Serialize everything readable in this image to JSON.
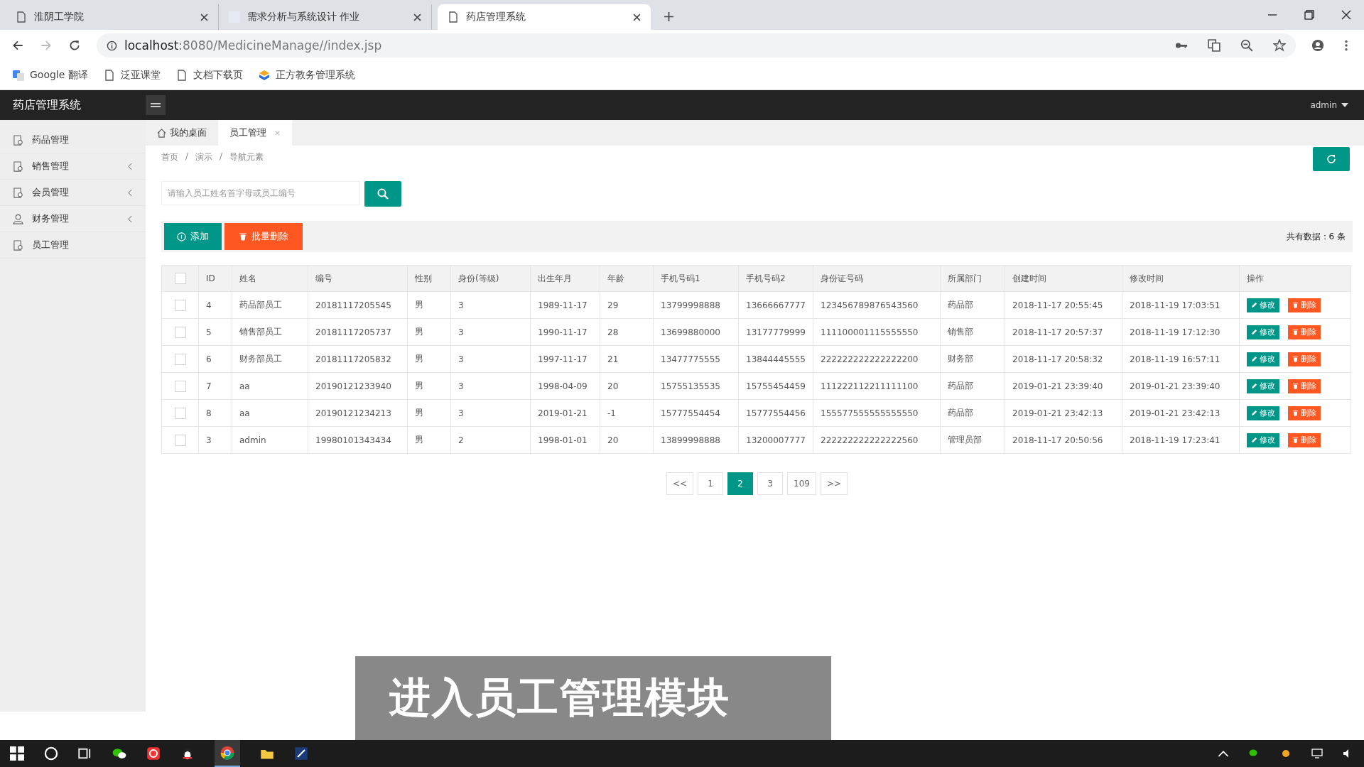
{
  "browser": {
    "tabs": [
      {
        "title": "淮阴工学院",
        "selected": false,
        "kind": "page"
      },
      {
        "title": "需求分析与系统设计  作业",
        "selected": false,
        "kind": "site"
      },
      {
        "title": "药店管理系统",
        "selected": true,
        "kind": "page"
      }
    ],
    "address": {
      "host": "localhost",
      "rest": ":8080/MedicineManage//index.jsp"
    },
    "bookmarks": [
      {
        "label": "Google 翻译",
        "kind": "translate"
      },
      {
        "label": "泛亚课堂",
        "kind": "page"
      },
      {
        "label": "文档下载页",
        "kind": "page"
      },
      {
        "label": "正方教务管理系统",
        "kind": "site"
      }
    ]
  },
  "app": {
    "title": "药店管理系统",
    "user": "admin",
    "sidebar": [
      {
        "label": "药品管理",
        "kind": "document",
        "expandable": false
      },
      {
        "label": "销售管理",
        "kind": "document",
        "expandable": true
      },
      {
        "label": "会员管理",
        "kind": "document",
        "expandable": true
      },
      {
        "label": "财务管理",
        "kind": "person",
        "expandable": true
      },
      {
        "label": "员工管理",
        "kind": "document",
        "expandable": false
      }
    ],
    "tabs": [
      {
        "label": "我的桌面",
        "selected": false,
        "kind": "home"
      },
      {
        "label": "员工管理",
        "selected": true,
        "kind": "closable"
      }
    ],
    "breadcrumb": [
      {
        "label": "首页"
      },
      {
        "separator": "/",
        "label": "演示"
      },
      {
        "separator": "/",
        "label": "导航元素"
      }
    ],
    "search": {
      "placeholder": "请输入员工姓名首字母或员工编号"
    },
    "toolbar": {
      "add": "添加",
      "batch_delete": "批量删除",
      "total": "共有数据：6 条"
    },
    "table": {
      "select_all_checked": false,
      "columns": [
        "ID",
        "姓名",
        "编号",
        "性别",
        "身份(等级)",
        "出生年月",
        "年龄",
        "手机号码1",
        "手机号码2",
        "身份证号码",
        "所属部门",
        "创建时间",
        "修改时间",
        "操作"
      ],
      "rows": [
        {
          "checked": false,
          "edit": "修改",
          "delete": "删除",
          "cells": [
            "4",
            "药品部员工",
            "20181117205545",
            "男",
            "3",
            "1989-11-17",
            "29",
            "13799998888",
            "13666667777",
            "123456789876543560",
            "药品部",
            "2018-11-17 20:55:45",
            "2018-11-19 17:03:51"
          ]
        },
        {
          "checked": false,
          "edit": "修改",
          "delete": "删除",
          "cells": [
            "5",
            "销售部员工",
            "20181117205737",
            "男",
            "3",
            "1990-11-17",
            "28",
            "13699880000",
            "13177779999",
            "111100001115555550",
            "销售部",
            "2018-11-17 20:57:37",
            "2018-11-19 17:12:30"
          ]
        },
        {
          "checked": false,
          "edit": "修改",
          "delete": "删除",
          "cells": [
            "6",
            "财务部员工",
            "20181117205832",
            "男",
            "3",
            "1997-11-17",
            "21",
            "13477775555",
            "13844445555",
            "222222222222222200",
            "财务部",
            "2018-11-17 20:58:32",
            "2018-11-19 16:57:11"
          ]
        },
        {
          "checked": false,
          "edit": "修改",
          "delete": "删除",
          "cells": [
            "7",
            "aa",
            "20190121233940",
            "男",
            "3",
            "1998-04-09",
            "20",
            "15755135535",
            "15755454459",
            "111222112211111100",
            "药品部",
            "2019-01-21 23:39:40",
            "2019-01-21 23:39:40"
          ]
        },
        {
          "checked": false,
          "edit": "修改",
          "delete": "删除",
          "cells": [
            "8",
            "aa",
            "20190121234213",
            "男",
            "3",
            "2019-01-21",
            "-1",
            "15777554454",
            "15777554456",
            "155577555555555550",
            "药品部",
            "2019-01-21 23:42:13",
            "2019-01-21 23:42:13"
          ]
        },
        {
          "checked": false,
          "edit": "修改",
          "delete": "删除",
          "cells": [
            "3",
            "admin",
            "19980101343434",
            "男",
            "2",
            "1998-01-01",
            "20",
            "13899998888",
            "13200007777",
            "222222222222222560",
            "管理员部",
            "2018-11-17 20:50:56",
            "2018-11-19 17:23:41"
          ]
        }
      ]
    },
    "pagination": [
      {
        "label": "<<",
        "selected": false
      },
      {
        "label": "1",
        "selected": false
      },
      {
        "label": "2",
        "selected": true
      },
      {
        "label": "3",
        "selected": false
      },
      {
        "label": "109",
        "selected": false
      },
      {
        "label": ">>",
        "selected": false
      }
    ]
  },
  "caption": "进入员工管理模块"
}
